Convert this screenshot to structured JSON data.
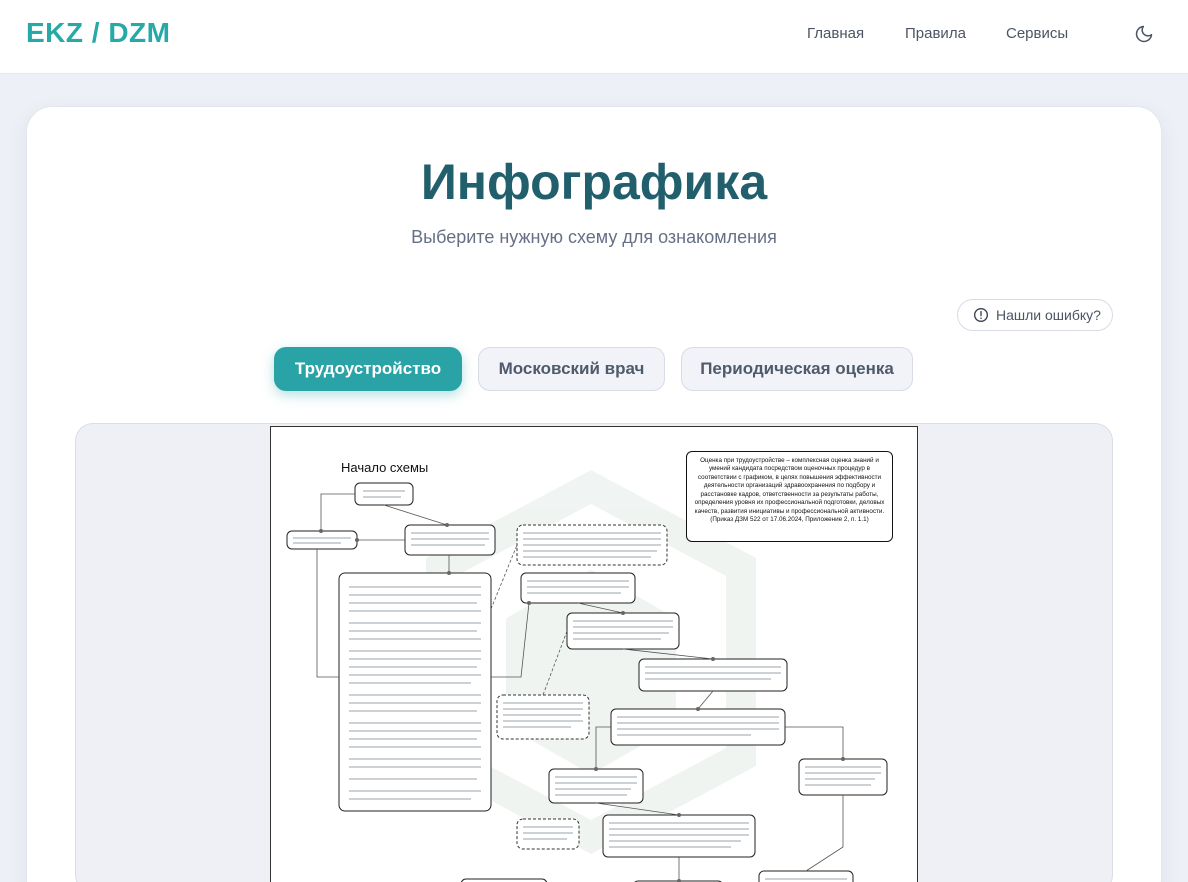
{
  "header": {
    "logo": "EKZ / DZM",
    "nav": [
      {
        "label": "Главная"
      },
      {
        "label": "Правила"
      },
      {
        "label": "Сервисы"
      }
    ],
    "theme_icon": "moon-icon"
  },
  "page": {
    "title": "Инфографика",
    "subtitle": "Выберите нужную схему для ознакомления"
  },
  "report": {
    "label": "Нашли ошибку?",
    "icon": "alert-circle-icon"
  },
  "tabs": [
    {
      "label": "Трудоустройство",
      "active": true
    },
    {
      "label": "Московский врач",
      "active": false
    },
    {
      "label": "Периодическая оценка",
      "active": false
    }
  ],
  "diagram": {
    "start_label": "Начало схемы",
    "note": "Оценка при трудоустройстве – комплексная оценка знаний и умений кандидата посредством оценочных процедур в соответствии с графиком, в целях повышения эффективности деятельности организаций здравоохранения по подбору и расстановке кадров, ответственности за результаты работы, определения уровня их профессиональной подготовки, деловых качеств, развития инициативы и профессиональной активности. (Приказ ДЗМ 522 от 17.06.2024, Приложение 2, п. 1.1)"
  },
  "colors": {
    "brand": "#27a9a7",
    "title": "#225f6d",
    "tab_active": "#2aa3a6"
  }
}
